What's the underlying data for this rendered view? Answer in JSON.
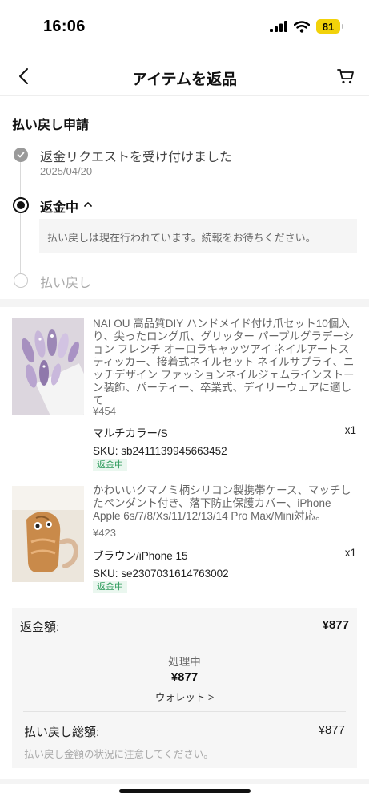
{
  "status_bar": {
    "time": "16:06",
    "battery": "81"
  },
  "nav": {
    "title": "アイテムを返品",
    "back_icon": "chevron-left-icon",
    "cart_icon": "cart-icon"
  },
  "refund_progress": {
    "title": "払い戻し申請",
    "steps": [
      {
        "label": "返金リクエストを受け付けました",
        "date": "2025/04/20",
        "state": "done"
      },
      {
        "label": "返金中",
        "note": "払い戻しは現在行われています。続報をお待ちください。",
        "state": "current"
      },
      {
        "label": "払い戻し",
        "state": "pending"
      }
    ]
  },
  "products": [
    {
      "title": "NAI OU 高品質DIY ハンドメイド付け爪セット10個入り、尖ったロング爪、グリッター パープルグラデーション フレンチ オーロラキャッツアイ ネイルアートスティッカー、接着式ネイルセット ネイルサプライ、ニッチデザイン ファッションネイルジェムラインストーン装飾、パーティー、卒業式、デイリーウェアに適して",
      "price": "¥454",
      "variant": "マルチカラー/S",
      "qty": "x1",
      "sku": "SKU: sb2411139945663452",
      "status": "返金中"
    },
    {
      "title": "かわいいクマノミ柄シリコン製携帯ケース、マッチしたペンダント付き、落下防止保護カバー、iPhone Apple 6s/7/8/Xs/11/12/13/14 Pro Max/Mini対応。",
      "price": "¥423",
      "variant": "ブラウン/iPhone 15",
      "qty": "x1",
      "sku": "SKU: se2307031614763002",
      "status": "返金中"
    }
  ],
  "summary": {
    "refund_label": "返金額:",
    "refund_amount": "¥877",
    "processing_label": "処理中",
    "processing_amount": "¥877",
    "wallet_link": "ウォレット >",
    "total_label": "払い戻し総額:",
    "total_amount": "¥877",
    "note": "払い戻し金額の状況に注意してください。"
  },
  "colors": {
    "accent_green": "#2c9a5a",
    "battery_yellow": "#f2d20a"
  }
}
